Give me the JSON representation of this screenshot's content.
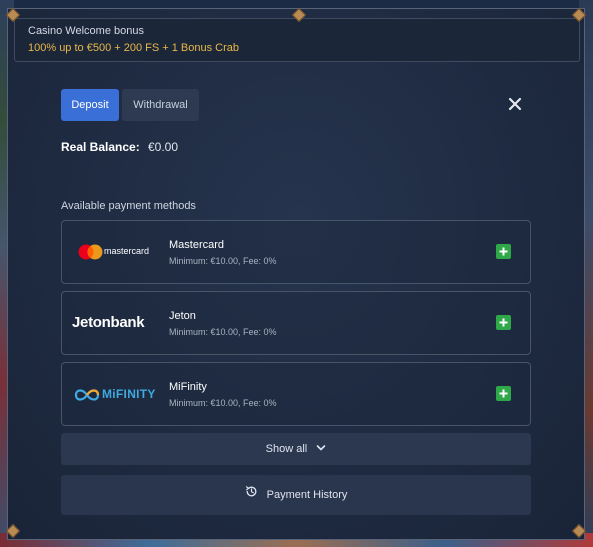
{
  "bonus": {
    "title": "Casino Welcome bonus",
    "offer": "100% up to €500 + 200 FS + 1 Bonus Crab"
  },
  "tabs": [
    {
      "label": "Deposit",
      "active": true
    },
    {
      "label": "Withdrawal",
      "active": false
    }
  ],
  "balance": {
    "label": "Real Balance:",
    "value": "€0.00"
  },
  "methods_heading": "Available payment methods",
  "methods": [
    {
      "logo": "mastercard",
      "name": "Mastercard",
      "info": "Minimum: €10.00, Fee: 0%"
    },
    {
      "logo": "Jetonbank",
      "name": "Jeton",
      "info": "Minimum: €10.00, Fee: 0%"
    },
    {
      "logo": "MiFINITY",
      "name": "MiFinity",
      "info": "Minimum: €10.00, Fee: 0%"
    }
  ],
  "show_all_label": "Show all",
  "payment_history_label": "Payment History",
  "colors": {
    "accent": "#3a6fd8",
    "add": "#2fa84a",
    "bonus_text": "#e8b84a",
    "mifinity": "#3fa9e0"
  },
  "icons": [
    "close-icon",
    "plus-icon",
    "chevron-down-icon",
    "history-icon"
  ]
}
